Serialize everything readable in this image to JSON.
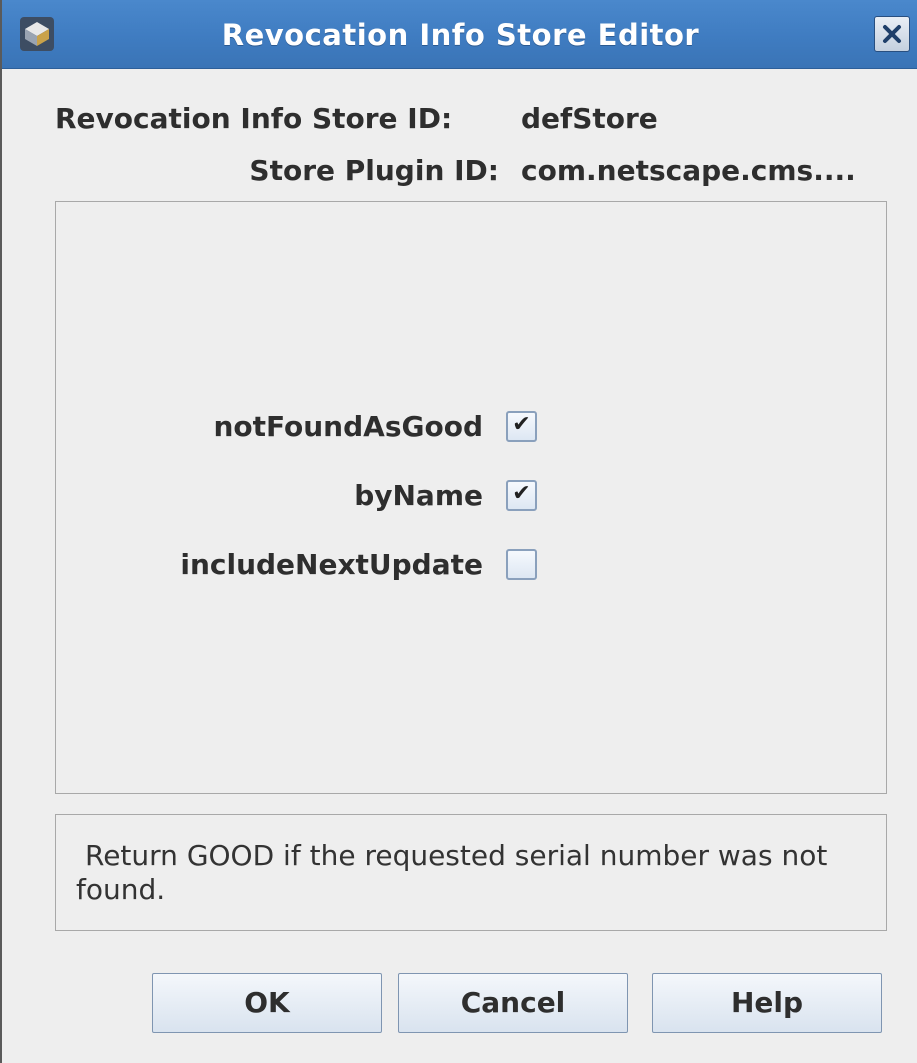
{
  "window": {
    "title": "Revocation Info Store Editor",
    "titlebar_color": "#3f7cc1",
    "icons": {
      "app": "app-icon",
      "close": "close-icon"
    }
  },
  "info": {
    "store_id_label": "Revocation Info Store ID:",
    "store_id_value": "defStore",
    "plugin_id_label": "Store Plugin ID:",
    "plugin_id_value": "com.netscape.cms...."
  },
  "params": [
    {
      "label": "notFoundAsGood",
      "checked": true
    },
    {
      "label": "byName",
      "checked": true
    },
    {
      "label": "includeNextUpdate",
      "checked": false
    }
  ],
  "help": {
    "text": "Return GOOD if the requested serial number was not found."
  },
  "buttons": {
    "ok": "OK",
    "cancel": "Cancel",
    "help": "Help"
  }
}
